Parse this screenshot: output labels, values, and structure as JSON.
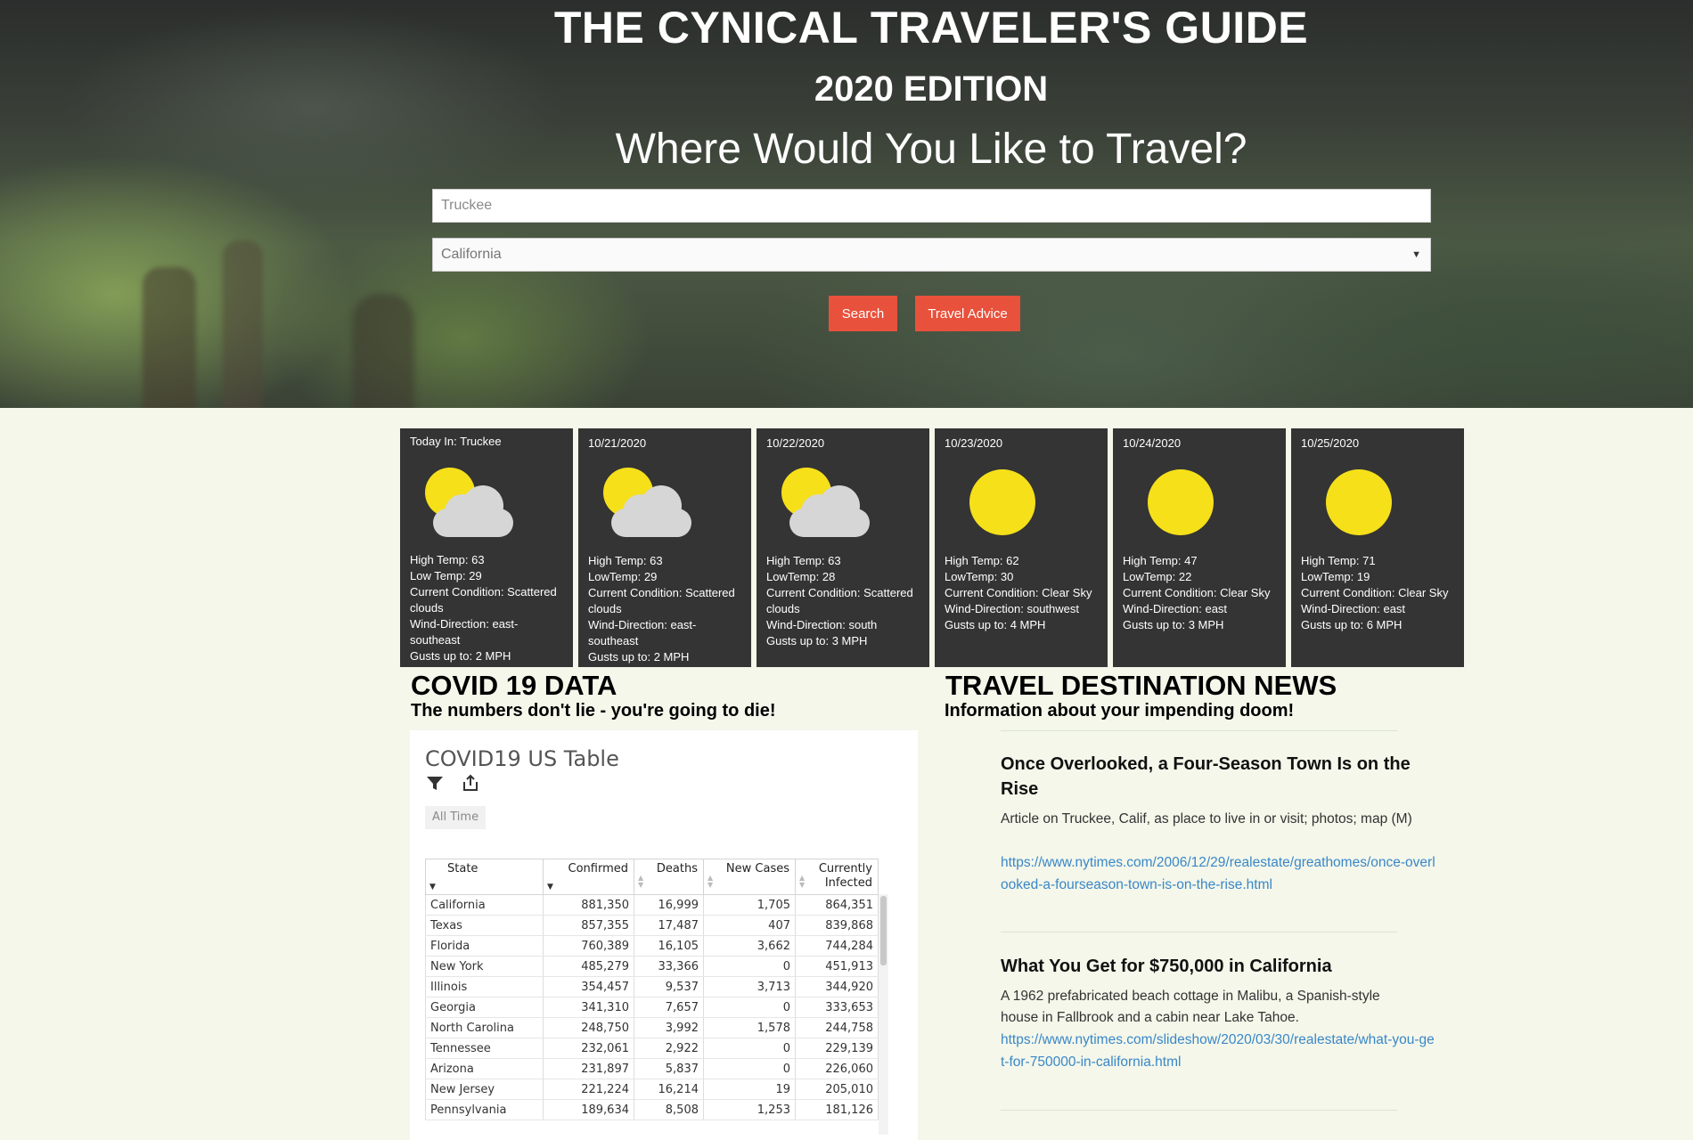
{
  "hero": {
    "title": "THE CYNICAL TRAVELER'S GUIDE",
    "edition": "2020 EDITION",
    "question": "Where Would You Like to Travel?",
    "city_input": {
      "value": "",
      "placeholder": "Truckee"
    },
    "state_select": {
      "selected": "California"
    },
    "search_label": "Search",
    "advice_label": "Travel Advice",
    "button_color": "#e8513b"
  },
  "weather": {
    "cards": [
      {
        "date": "Today In: Truckee",
        "icon": "partly-cloudy-icon",
        "lines": [
          "High Temp: 63",
          "Low Temp: 29",
          "Current Condition: Scattered clouds",
          "Wind-Direction: east-southeast",
          "Gusts up to: 2 MPH"
        ]
      },
      {
        "date": "10/21/2020",
        "icon": "partly-cloudy-icon",
        "lines": [
          "High Temp: 63",
          "LowTemp: 29",
          "Current Condition: Scattered clouds",
          "Wind-Direction: east-southeast",
          "Gusts up to: 2 MPH"
        ]
      },
      {
        "date": "10/22/2020",
        "icon": "partly-cloudy-icon",
        "lines": [
          "High Temp: 63",
          "LowTemp: 28",
          "Current Condition: Scattered clouds",
          "Wind-Direction: south",
          "Gusts up to: 3 MPH"
        ]
      },
      {
        "date": "10/23/2020",
        "icon": "sun-icon",
        "lines": [
          "High Temp: 62",
          "LowTemp: 30",
          "Current Condition: Clear Sky",
          "Wind-Direction: southwest",
          "Gusts up to: 4 MPH"
        ]
      },
      {
        "date": "10/24/2020",
        "icon": "sun-icon",
        "lines": [
          "High Temp: 47",
          "LowTemp: 22",
          "Current Condition: Clear Sky",
          "Wind-Direction: east",
          "Gusts up to: 3 MPH"
        ]
      },
      {
        "date": "10/25/2020",
        "icon": "sun-icon",
        "lines": [
          "High Temp: 71",
          "LowTemp: 19",
          "Current Condition: Clear Sky",
          "Wind-Direction: east",
          "Gusts up to: 6 MPH"
        ]
      }
    ]
  },
  "covid": {
    "title": "COVID 19 DATA",
    "subtitle": "The numbers don't lie - you're going to die!",
    "panel_title": "COVID19 US Table",
    "filter_icon": "filter-icon",
    "share_icon": "share-icon",
    "time_filter": "All Time",
    "columns": [
      "State",
      "Confirmed",
      "Deaths",
      "New Cases",
      "Currently Infected"
    ],
    "rows": [
      [
        "California",
        "881,350",
        "16,999",
        "1,705",
        "864,351"
      ],
      [
        "Texas",
        "857,355",
        "17,487",
        "407",
        "839,868"
      ],
      [
        "Florida",
        "760,389",
        "16,105",
        "3,662",
        "744,284"
      ],
      [
        "New York",
        "485,279",
        "33,366",
        "0",
        "451,913"
      ],
      [
        "Illinois",
        "354,457",
        "9,537",
        "3,713",
        "344,920"
      ],
      [
        "Georgia",
        "341,310",
        "7,657",
        "0",
        "333,653"
      ],
      [
        "North Carolina",
        "248,750",
        "3,992",
        "1,578",
        "244,758"
      ],
      [
        "Tennessee",
        "232,061",
        "2,922",
        "0",
        "229,139"
      ],
      [
        "Arizona",
        "231,897",
        "5,837",
        "0",
        "226,060"
      ],
      [
        "New Jersey",
        "221,224",
        "16,214",
        "19",
        "205,010"
      ],
      [
        "Pennsylvania",
        "189,634",
        "8,508",
        "1,253",
        "181,126"
      ]
    ]
  },
  "news": {
    "title": "TRAVEL DESTINATION NEWS",
    "subtitle": "Information about your impending doom!",
    "articles": [
      {
        "headline": "Once Overlooked, a Four-Season Town Is on the Rise",
        "description": "Article on Truckee, Calif, as place to live in or visit; photos; map (M)",
        "url": "https://www.nytimes.com/2006/12/29/realestate/greathomes/once-overlooked-a-fourseason-town-is-on-the-rise.html"
      },
      {
        "headline": "What You Get for $750,000 in California",
        "description": "A 1962 prefabricated beach cottage in Malibu, a Spanish-style house in Fallbrook and a cabin near Lake Tahoe.",
        "url": "https://www.nytimes.com/slideshow/2020/03/30/realestate/what-you-get-for-750000-in-california.html"
      }
    ]
  }
}
